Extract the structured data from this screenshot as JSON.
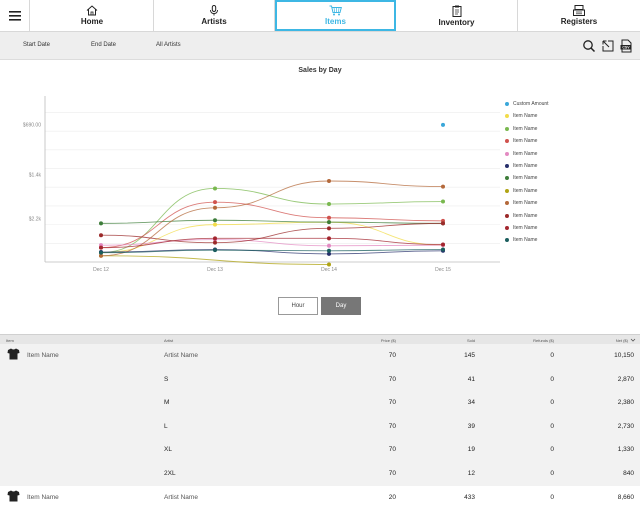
{
  "nav": {
    "tabs": [
      {
        "label": "Home",
        "icon": "home-icon",
        "active": false
      },
      {
        "label": "Artists",
        "icon": "microphone-icon",
        "active": false
      },
      {
        "label": "Items",
        "icon": "cart-icon",
        "active": true
      },
      {
        "label": "Inventory",
        "icon": "clipboard-icon",
        "active": false
      },
      {
        "label": "Registers",
        "icon": "register-icon",
        "active": false
      }
    ],
    "accent": "#3db7e4"
  },
  "filters": {
    "start_date": "Start Date",
    "end_date": "End Date",
    "artist": "All Artists"
  },
  "toolbar_icons": [
    "search-icon",
    "export-icon",
    "csv-icon"
  ],
  "chart": {
    "title": "Sales by Day",
    "y_ticks": [
      "$2.2k",
      "$1.4k",
      "$690.00"
    ],
    "x_ticks": [
      "Dec 12",
      "Dec 13",
      "Dec 14",
      "Dec 15"
    ],
    "legend": [
      {
        "label": "Custom Amount",
        "color": "#3aa7d9"
      },
      {
        "label": "Item Name",
        "color": "#f2dc4a"
      },
      {
        "label": "Item Name",
        "color": "#79b84f"
      },
      {
        "label": "Item Name",
        "color": "#d0524d"
      },
      {
        "label": "Item Name",
        "color": "#e38ac2"
      },
      {
        "label": "Item Name",
        "color": "#262f6b"
      },
      {
        "label": "Item Name",
        "color": "#3d7d3a"
      },
      {
        "label": "Item Name",
        "color": "#b0a414"
      },
      {
        "label": "Item Name",
        "color": "#b4693b"
      },
      {
        "label": "Item Name",
        "color": "#9b2a2a"
      },
      {
        "label": "Item Name",
        "color": "#a3262f"
      },
      {
        "label": "Item Name",
        "color": "#1b5e5e"
      }
    ],
    "toggle": {
      "hour": "Hour",
      "day": "Day",
      "selected": "Day"
    }
  },
  "chart_data": {
    "type": "line",
    "title": "Sales by Day",
    "categories": [
      "Dec 12",
      "Dec 13",
      "Dec 14",
      "Dec 15"
    ],
    "ylim": [
      0,
      2600
    ],
    "y_ticks": [
      690,
      1400,
      2200
    ],
    "series": [
      {
        "name": "Custom Amount",
        "color": "#3aa7d9",
        "values": [
          null,
          null,
          null,
          2200
        ]
      },
      {
        "name": "Item Name",
        "color": "#f2dc4a",
        "values": [
          150,
          600,
          640,
          270
        ]
      },
      {
        "name": "Item Name",
        "color": "#79b84f",
        "values": [
          150,
          1180,
          930,
          970
        ]
      },
      {
        "name": "Item Name",
        "color": "#d0524d",
        "values": [
          230,
          960,
          710,
          660
        ]
      },
      {
        "name": "Item Name",
        "color": "#e38ac2",
        "values": [
          270,
          360,
          260,
          270
        ]
      },
      {
        "name": "Item Name",
        "color": "#262f6b",
        "values": [
          160,
          200,
          130,
          180
        ]
      },
      {
        "name": "Item Name",
        "color": "#3d7d3a",
        "values": [
          620,
          670,
          640,
          620
        ]
      },
      {
        "name": "Item Name",
        "color": "#b0a414",
        "values": [
          100,
          null,
          -40,
          null
        ]
      },
      {
        "name": "Item Name",
        "color": "#b4693b",
        "values": [
          100,
          870,
          1300,
          1210
        ]
      },
      {
        "name": "Item Name",
        "color": "#9b2a2a",
        "values": [
          430,
          310,
          540,
          620
        ]
      },
      {
        "name": "Item Name",
        "color": "#a3262f",
        "values": [
          230,
          380,
          380,
          280
        ]
      },
      {
        "name": "Item Name",
        "color": "#1b5e5e",
        "values": [
          150,
          190,
          180,
          200
        ]
      }
    ]
  },
  "table": {
    "headers": {
      "item": "Item",
      "artist": "Artist",
      "price": "Price ($)",
      "sold": "Sold",
      "refunds": "Refunds ($)",
      "net": "Net ($)"
    },
    "rows": [
      {
        "item": "Item Name",
        "artist": "Artist Name",
        "price": "70",
        "sold": "145",
        "refunds": "0",
        "net": "10,150",
        "type": "product"
      },
      {
        "item": "",
        "artist": "S",
        "price": "70",
        "sold": "41",
        "refunds": "0",
        "net": "2,870",
        "type": "variant"
      },
      {
        "item": "",
        "artist": "M",
        "price": "70",
        "sold": "34",
        "refunds": "0",
        "net": "2,380",
        "type": "variant"
      },
      {
        "item": "",
        "artist": "L",
        "price": "70",
        "sold": "39",
        "refunds": "0",
        "net": "2,730",
        "type": "variant"
      },
      {
        "item": "",
        "artist": "XL",
        "price": "70",
        "sold": "19",
        "refunds": "0",
        "net": "1,330",
        "type": "variant"
      },
      {
        "item": "",
        "artist": "2XL",
        "price": "70",
        "sold": "12",
        "refunds": "0",
        "net": "840",
        "type": "variant"
      },
      {
        "item": "Item Name",
        "artist": "Artist Name",
        "price": "20",
        "sold": "433",
        "refunds": "0",
        "net": "8,660",
        "type": "product"
      }
    ]
  }
}
